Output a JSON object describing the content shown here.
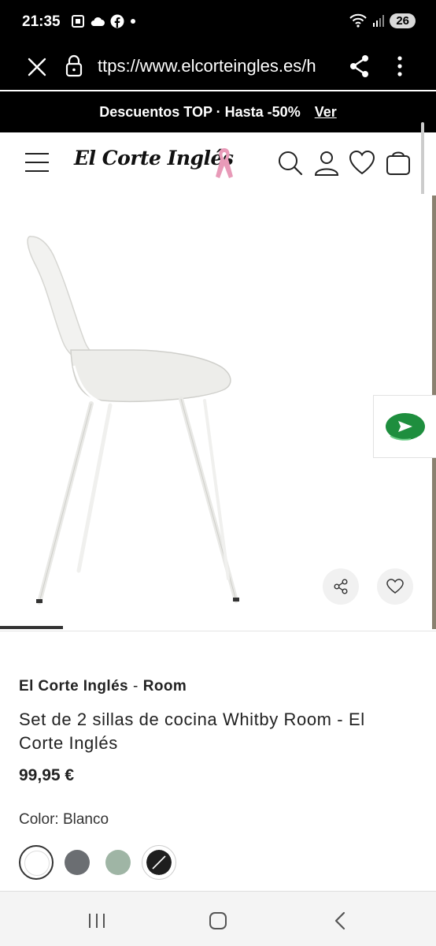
{
  "status_bar": {
    "time": "21:35",
    "battery": "26"
  },
  "browser": {
    "url": "ttps://www.elcorteingles.es/h"
  },
  "promo": {
    "text": "Descuentos TOP · Hasta -50%",
    "link": "Ver"
  },
  "header": {
    "logo_text": "El Corte Inglés"
  },
  "product": {
    "brand_primary": "El Corte Inglés",
    "separator": "-",
    "brand_secondary": "Room",
    "title": "Set de 2 sillas de cocina Whitby Room - El Corte Inglés",
    "price": "99,95 €",
    "color_label": "Color: Blanco",
    "swatches": [
      {
        "name": "Blanco",
        "color": "#ffffff",
        "selected": true
      },
      {
        "name": "Gris oscuro",
        "color": "#6b6e72",
        "selected": false
      },
      {
        "name": "Verde",
        "color": "#9fb5a5",
        "selected": false
      },
      {
        "name": "Negro",
        "color": "#1e1e1e",
        "selected": false
      }
    ]
  },
  "colors": {
    "bar_background": "#000000",
    "ribbon": "#e89ab8",
    "chat": "#1e8e3e"
  }
}
